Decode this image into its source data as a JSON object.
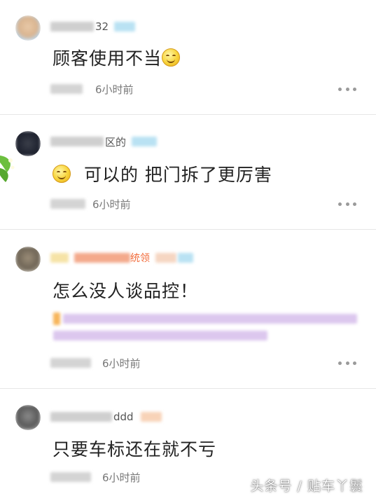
{
  "comments": [
    {
      "username_suffix": "32",
      "text": "顾客使用不当",
      "emoji": "smile-emoji",
      "time": "6小时前"
    },
    {
      "username_suffix": "区的",
      "text": "可以的 把门拆了更厉害",
      "emoji": "smile-emoji",
      "time": "6小时前"
    },
    {
      "username_suffix": "",
      "badge_text": "统领",
      "text": "怎么没人谈品控！",
      "time": "6小时前"
    },
    {
      "username_suffix": "ddd",
      "text": "只要车标还在就不亏",
      "time": "6小时前"
    }
  ],
  "watermark": "头条号 / 贴车丫鬟",
  "colors": {
    "badge": "#f26b3a",
    "blur_pink": "#e9c6f0",
    "blur_blue": "#b9e2f3",
    "divider": "#e6e6e6"
  }
}
